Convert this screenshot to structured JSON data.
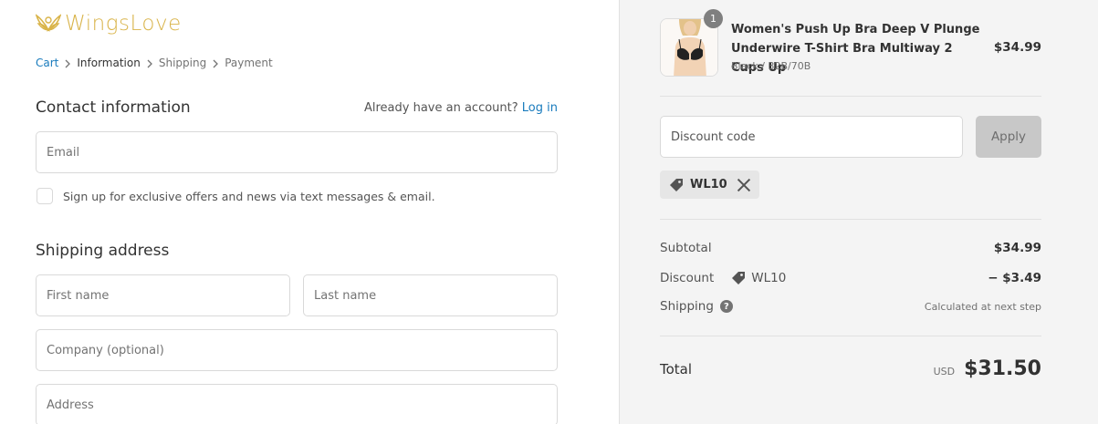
{
  "brand": {
    "name": "WingsLove",
    "color": "#d9b44a"
  },
  "breadcrumb": [
    {
      "label": "Cart",
      "state": "link"
    },
    {
      "label": "Information",
      "state": "current"
    },
    {
      "label": "Shipping",
      "state": "upcoming"
    },
    {
      "label": "Payment",
      "state": "upcoming"
    }
  ],
  "contact": {
    "title": "Contact information",
    "account_prompt": "Already have an account?",
    "login_label": "Log in",
    "email_placeholder": "Email",
    "marketing_label": "Sign up for exclusive offers and news via text messages & email."
  },
  "shipping": {
    "title": "Shipping address",
    "first_name_placeholder": "First name",
    "last_name_placeholder": "Last name",
    "company_placeholder": "Company (optional)",
    "address_placeholder": "Address"
  },
  "order": {
    "quantity": "1",
    "product_title": "Women's Push Up Bra Deep V Plunge Underwire T-Shirt Bra Multiway 2 Cups Up",
    "variant": "Black / 32B/70B",
    "price": "$34.99",
    "discount_placeholder": "Discount code",
    "apply_label": "Apply",
    "applied_code": "WL10",
    "subtotal_label": "Subtotal",
    "subtotal_value": "$34.99",
    "discount_label": "Discount",
    "discount_code": "WL10",
    "discount_value": "− $3.49",
    "shipping_label": "Shipping",
    "shipping_value": "Calculated at next step",
    "total_label": "Total",
    "currency": "USD",
    "total_value": "$31.50"
  }
}
